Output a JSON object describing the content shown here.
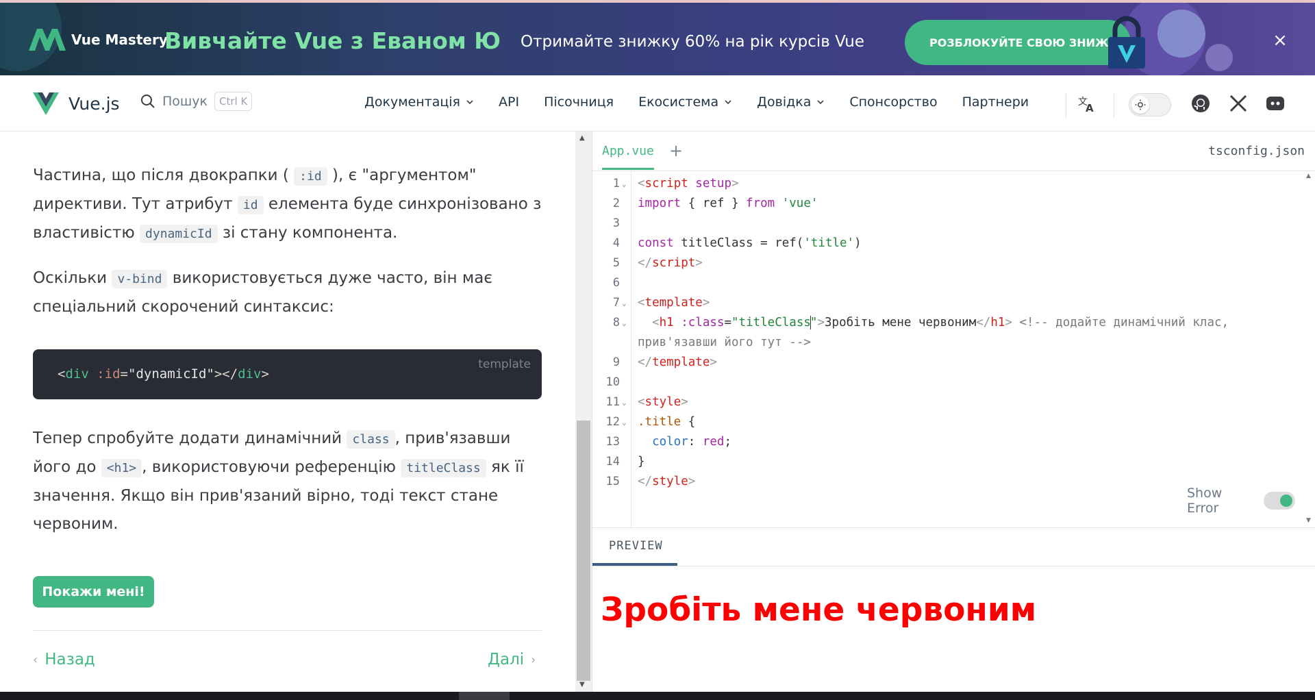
{
  "banner": {
    "brand": "Vue Mastery",
    "title": "Вивчайте Vue з Еваном Ю",
    "subtitle": "Отримайте знижку 60% на рік курсів Vue",
    "cta": "РОЗБЛОКУЙТЕ СВОЮ ЗНИЖ",
    "close": "×"
  },
  "nav": {
    "brand": "Vue.js",
    "search_label": "Пошук",
    "search_shortcut": "Ctrl K",
    "links": [
      "Документація",
      "API",
      "Пісочниця",
      "Екосистема",
      "Довідка",
      "Спонсорство",
      "Партнери"
    ],
    "icons": [
      "translate-icon",
      "theme-toggle",
      "github-icon",
      "x-icon",
      "discord-icon"
    ]
  },
  "tutorial": {
    "p1_a": "Частина, що після двокрапки ( ",
    "p1_code1": ":id",
    "p1_b": " ), є \"аргументом\" директиви. Тут атрибут ",
    "p1_code2": "id",
    "p1_c": " елемента буде синхронізовано з властивістю ",
    "p1_code3": "dynamicId",
    "p1_d": " зі стану компонента.",
    "p2_a": "Оскільки ",
    "p2_code": "v-bind",
    "p2_b": " використовується дуже часто, він має спеціальний скорочений синтаксис:",
    "code_lang": "template",
    "code_line": {
      "open": "<",
      "tag": "div",
      "attr": " :id",
      "eq": "=",
      "str": "\"dynamicId\"",
      "close": "></",
      "tag2": "div",
      "end": ">"
    },
    "p3_a": "Тепер спробуйте додати динамічний ",
    "p3_code1": "class",
    "p3_b": ", прив'язавши його до ",
    "p3_code2": "<h1>",
    "p3_c": ", використовуючи референцію ",
    "p3_code3": "titleClass",
    "p3_d": " як її значення. Якщо він прив'язаний вірно, тоді текст стане червоним.",
    "show_button": "Покажи мені!",
    "prev": "Назад",
    "next": "Далі"
  },
  "editor": {
    "tabs": {
      "active": "App.vue",
      "add": "+",
      "config": "tsconfig.json"
    },
    "line_numbers": [
      "1",
      "2",
      "3",
      "4",
      "5",
      "6",
      "7",
      "8",
      "9",
      "10",
      "11",
      "12",
      "13",
      "14",
      "15"
    ],
    "code": {
      "l1_open": "<",
      "l1_tag": "script",
      "l1_attr": " setup",
      "l1_close": ">",
      "l2_kw": "import",
      "l2_mid": " { ref } ",
      "l2_from": "from",
      "l2_str": " 'vue'",
      "l4_kw": "const",
      "l4_mid": " titleClass = ref(",
      "l4_str": "'title'",
      "l4_end": ")",
      "l5_open": "</",
      "l5_tag": "script",
      "l5_close": ">",
      "l7_open": "<",
      "l7_tag": "template",
      "l7_close": ">",
      "l8_open": "  <",
      "l8_tag": "h1",
      "l8_attr": " :class",
      "l8_eq": "=",
      "l8_str1": "\"titleClass",
      "l8_str2": "\"",
      "l8_close": ">",
      "l8_text": "Зробіть мене червоним",
      "l8_etag_open": "</",
      "l8_etag": "h1",
      "l8_etag_close": ">",
      "l8_comment": " <!-- додайте динамічний клас,",
      "l8_wrap": "прив'язавши його тут -->",
      "l9_open": "</",
      "l9_tag": "template",
      "l9_close": ">",
      "l11_open": "<",
      "l11_tag": "style",
      "l11_close": ">",
      "l12_sel": ".title",
      "l12_brace": " {",
      "l13_prop": "  color",
      "l13_colon": ": ",
      "l13_val": "red",
      "l13_semi": ";",
      "l14": "}",
      "l15_open": "</",
      "l15_tag": "style",
      "l15_close": ">"
    },
    "show_error_label": "Show Error"
  },
  "preview": {
    "tab": "PREVIEW",
    "heading": "Зробіть мене червоним"
  },
  "colors": {
    "accent": "#42b883",
    "preview_text": "#ff0000",
    "code_bg": "#292b35"
  }
}
